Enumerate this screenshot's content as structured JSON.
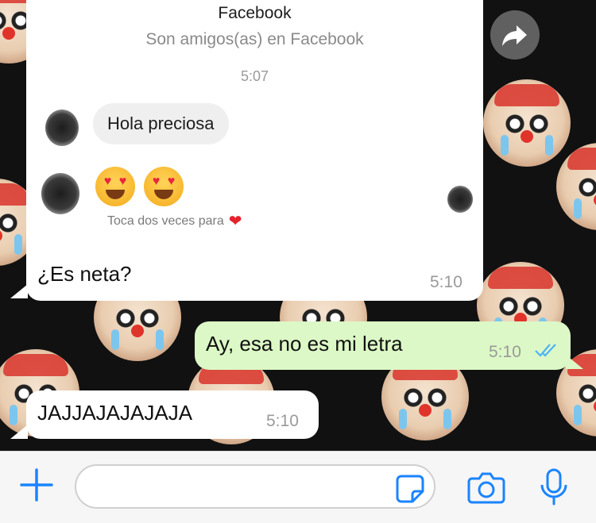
{
  "facebook_card": {
    "name": "Facebook",
    "subtitle": "Son amigos(as) en Facebook",
    "time": "5:07",
    "messages": [
      {
        "text": "Hola preciosa"
      }
    ],
    "reaction_hint": "Toca dos veces para"
  },
  "conversation": {
    "messages": [
      {
        "direction": "incoming",
        "text": "¿Es neta?",
        "time": "5:10"
      },
      {
        "direction": "outgoing",
        "text": "Ay, esa no es mi letra",
        "time": "5:10",
        "status": "read"
      },
      {
        "direction": "incoming",
        "text": "JAJJAJAJAJAJA",
        "time": "5:10"
      }
    ]
  },
  "input_bar": {
    "text_value": "",
    "accent_color": "#1a84ff"
  },
  "colors": {
    "outgoing_bubble": "#dcf8c6",
    "incoming_bubble": "#ffffff",
    "read_ticks": "#4fb3f6"
  }
}
